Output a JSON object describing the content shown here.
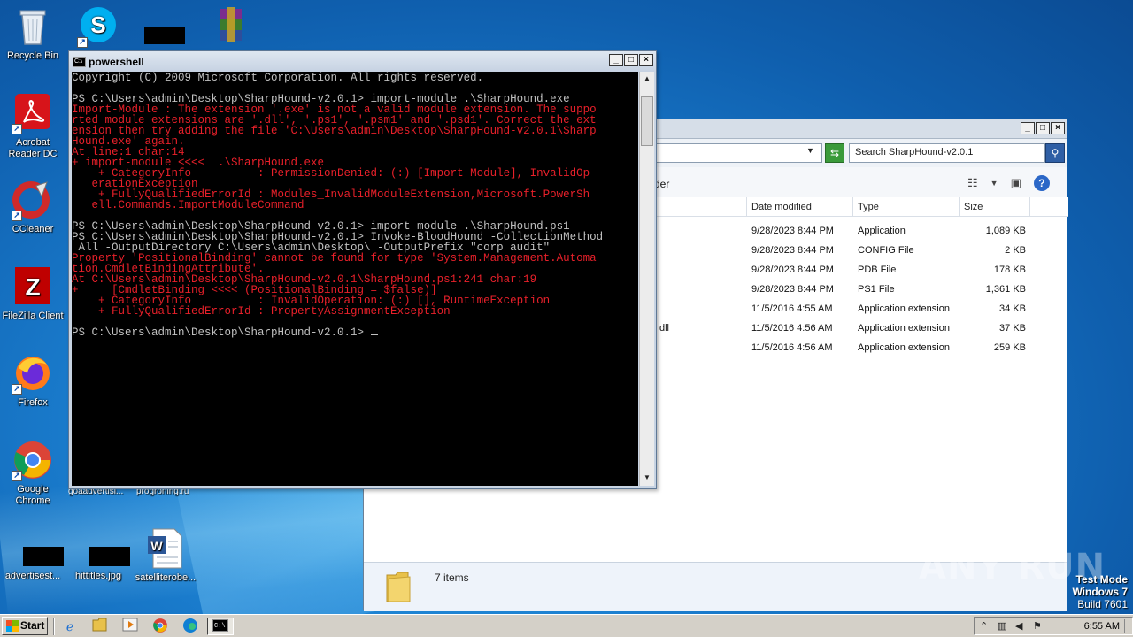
{
  "desktop": {
    "icons": [
      {
        "label": "Recycle Bin"
      },
      {
        "label": "Acrobat Reader DC"
      },
      {
        "label": "CCleaner"
      },
      {
        "label": "FileZilla Client"
      },
      {
        "label": "Firefox"
      },
      {
        "label": "Google Chrome"
      },
      {
        "label": "advertisest..."
      },
      {
        "label": "hittitles.jpg"
      },
      {
        "label": "satelliterobe..."
      }
    ],
    "obscured_labels": [
      "goaadvertisi...",
      "progroning.ru"
    ]
  },
  "console": {
    "title": "powershell",
    "lines": [
      {
        "text": "Copyright (C) 2009 Microsoft Corporation. All rights reserved.",
        "color": "w"
      },
      {
        "text": "",
        "color": "w"
      },
      {
        "text": "PS C:\\Users\\admin\\Desktop\\SharpHound-v2.0.1> import-module .\\SharpHound.exe",
        "color": "w"
      },
      {
        "text": "Import-Module : The extension '.exe' is not a valid module extension. The suppo",
        "color": "r"
      },
      {
        "text": "rted module extensions are '.dll', '.ps1', '.psm1' and '.psd1'. Correct the ext",
        "color": "r"
      },
      {
        "text": "ension then try adding the file 'C:\\Users\\admin\\Desktop\\SharpHound-v2.0.1\\Sharp",
        "color": "r"
      },
      {
        "text": "Hound.exe' again.",
        "color": "r"
      },
      {
        "text": "At line:1 char:14",
        "color": "r"
      },
      {
        "text": "+ import-module <<<<  .\\SharpHound.exe",
        "color": "r"
      },
      {
        "text": "    + CategoryInfo          : PermissionDenied: (:) [Import-Module], InvalidOp",
        "color": "r"
      },
      {
        "text": "   erationException",
        "color": "r"
      },
      {
        "text": "    + FullyQualifiedErrorId : Modules_InvalidModuleExtension,Microsoft.PowerSh",
        "color": "r"
      },
      {
        "text": "   ell.Commands.ImportModuleCommand",
        "color": "r"
      },
      {
        "text": "",
        "color": "w"
      },
      {
        "text": "PS C:\\Users\\admin\\Desktop\\SharpHound-v2.0.1> import-module .\\SharpHound.ps1",
        "color": "w"
      },
      {
        "text": "PS C:\\Users\\admin\\Desktop\\SharpHound-v2.0.1> Invoke-BloodHound -CollectionMethod",
        "color": "w"
      },
      {
        "text": " All -OutputDirectory C:\\Users\\admin\\Desktop\\ -OutputPrefix \"corp audit\"",
        "color": "w"
      },
      {
        "text": "Property 'PositionalBinding' cannot be found for type 'System.Management.Automa",
        "color": "r"
      },
      {
        "text": "tion.CmdletBindingAttribute'.",
        "color": "r"
      },
      {
        "text": "At C:\\Users\\admin\\Desktop\\SharpHound-v2.0.1\\SharpHound.ps1:241 char:19",
        "color": "r"
      },
      {
        "text": "+     [CmdletBinding <<<< (PositionalBinding = $false)]",
        "color": "r"
      },
      {
        "text": "    + CategoryInfo          : InvalidOperation: (:) [], RuntimeException",
        "color": "r"
      },
      {
        "text": "    + FullyQualifiedErrorId : PropertyAssignmentException",
        "color": "r"
      },
      {
        "text": "",
        "color": "w"
      }
    ],
    "prompt": "PS C:\\Users\\admin\\Desktop\\SharpHound-v2.0.1> "
  },
  "explorer": {
    "search_placeholder": "Search SharpHound-v2.0.1",
    "toolbar_text": "der",
    "columns": [
      "Date modified",
      "Type",
      "Size"
    ],
    "files": [
      {
        "name": "",
        "date": "9/28/2023 8:44 PM",
        "type": "Application",
        "size": "1,089 KB"
      },
      {
        "name": "",
        "date": "9/28/2023 8:44 PM",
        "type": "CONFIG File",
        "size": "2 KB"
      },
      {
        "name": "",
        "date": "9/28/2023 8:44 PM",
        "type": "PDB File",
        "size": "178 KB"
      },
      {
        "name": "",
        "date": "9/28/2023 8:44 PM",
        "type": "PS1 File",
        "size": "1,361 KB"
      },
      {
        "name": "",
        "date": "11/5/2016 4:55 AM",
        "type": "Application extension",
        "size": "34 KB"
      },
      {
        "name": "dll",
        "date": "11/5/2016 4:56 AM",
        "type": "Application extension",
        "size": "37 KB"
      },
      {
        "name": "",
        "date": "11/5/2016 4:56 AM",
        "type": "Application extension",
        "size": "259 KB"
      }
    ],
    "status": "7 items"
  },
  "watermark": "ANY RUN",
  "test_mode": {
    "line1": "Test Mode",
    "line2": "Windows 7",
    "line3": "Build 7601"
  },
  "taskbar": {
    "start_label": "Start",
    "clock": "6:55 AM"
  }
}
